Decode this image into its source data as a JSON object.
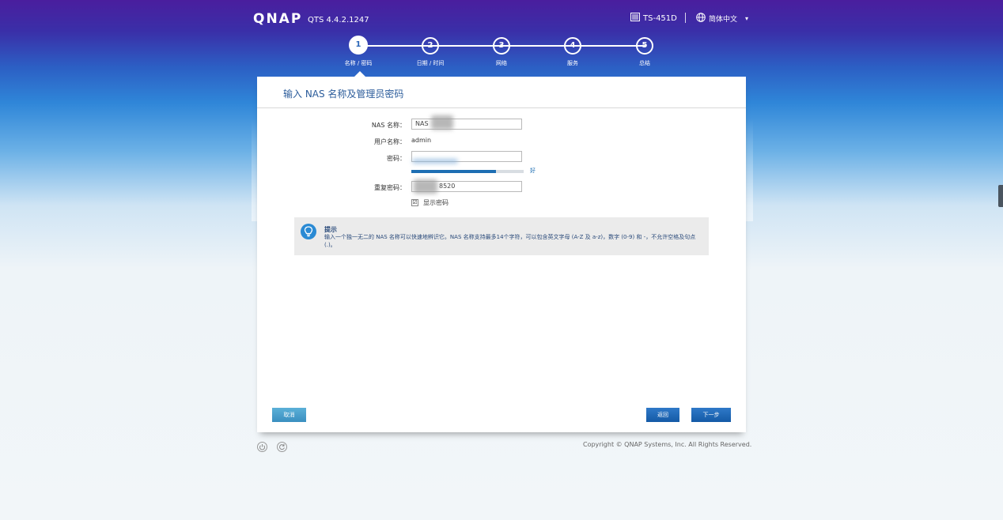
{
  "header": {
    "logo": "QNAP",
    "version": "QTS 4.4.2.1247",
    "model": "TS-451D",
    "language": "简体中文",
    "language_caret": "▾"
  },
  "steps": [
    {
      "num": "1",
      "label": "名称 / 密码",
      "active": true
    },
    {
      "num": "2",
      "label": "日期 / 时间",
      "active": false
    },
    {
      "num": "3",
      "label": "网络",
      "active": false
    },
    {
      "num": "4",
      "label": "服务",
      "active": false
    },
    {
      "num": "5",
      "label": "总结",
      "active": false
    }
  ],
  "panel": {
    "title": "输入 NAS 名称及管理员密码",
    "nas_name_label": "NAS 名称：",
    "nas_name_value": "NAS",
    "username_label": "用户名称：",
    "username_value": "admin",
    "password_label": "密码：",
    "password_value": "",
    "strength_text": "好",
    "strength_fraction": 0.75,
    "confirm_label": "重复密码：",
    "confirm_value": "8520",
    "show_password_label": "显示密码",
    "show_password_checked": "☑"
  },
  "hint": {
    "title": "提示",
    "text": "输入一个独一无二的 NAS 名称可以快速地辨识它。NAS 名称支持最多14个字符，可以包含英文字母 (A-Z 及 a-z)，数字 (0-9) 和 -，不允许空格及句点 (.)。"
  },
  "buttons": {
    "cancel": "取消",
    "back": "返回",
    "next": "下一步"
  },
  "footer": {
    "copyright": "Copyright © QNAP Systems, Inc. All Rights Reserved."
  },
  "colors": {
    "accent": "#1d6eb3",
    "title": "#2a5b9a"
  }
}
